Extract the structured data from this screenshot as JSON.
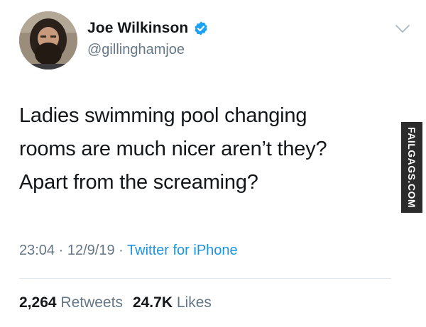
{
  "user": {
    "display_name": "Joe Wilkinson",
    "handle": "@gillinghamjoe",
    "verified": true
  },
  "tweet": {
    "text_lines": [
      "Ladies swimming pool changing",
      "rooms are much nicer aren’t they?",
      "Apart from the screaming?"
    ],
    "time": "23:04",
    "date": "12/9/19",
    "separator": "·",
    "source": "Twitter for iPhone"
  },
  "stats": {
    "retweets_count": "2,264",
    "retweets_label": "Retweets",
    "likes_count": "24.7K",
    "likes_label": "Likes"
  },
  "watermark": "FAILGAGS.COM",
  "icons": {
    "verified": "verified-badge-icon",
    "caret": "chevron-down-icon"
  },
  "colors": {
    "text": "#14171a",
    "secondary": "#657786",
    "link": "#1b95e0",
    "verified": "#1da1f2",
    "divider": "#e1e8ed",
    "watermark_bg": "#2b2b2b"
  }
}
